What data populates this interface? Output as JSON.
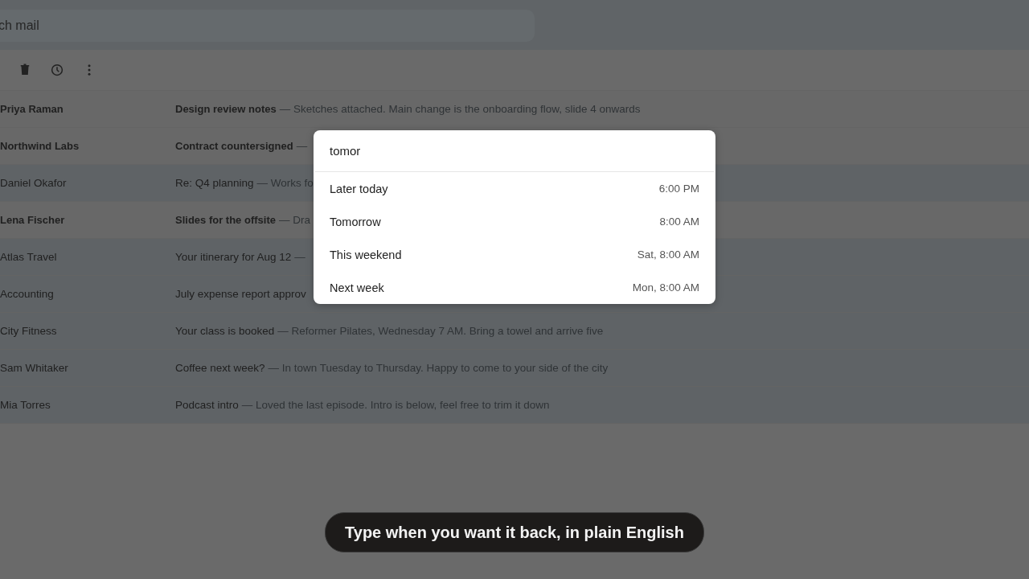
{
  "search": {
    "placeholder": "ch mail"
  },
  "messages": [
    {
      "sender": "Priya Raman",
      "subject": "Design review notes",
      "snippet": "— Sketches attached. Main change is the onboarding flow, slide 4 onwards",
      "unread": true
    },
    {
      "sender": "Northwind Labs",
      "subject": "Contract countersigned",
      "snippet": "—",
      "unread": true
    },
    {
      "sender": "Daniel Okafor",
      "subject": "Re: Q4 planning",
      "snippet": "— Works fo",
      "unread": false
    },
    {
      "sender": "Lena Fischer",
      "subject": "Slides for the offsite",
      "snippet": "— Dra",
      "unread": true
    },
    {
      "sender": "Atlas Travel",
      "subject": "Your itinerary for Aug 12",
      "snippet": "—",
      "unread": false
    },
    {
      "sender": "Accounting",
      "subject": "July expense report approv",
      "unread": false
    },
    {
      "sender": "City Fitness",
      "subject": "Your class is booked",
      "snippet": "— Reformer Pilates, Wednesday 7 AM. Bring a towel and arrive five",
      "unread": false
    },
    {
      "sender": "Sam Whitaker",
      "subject": "Coffee next week?",
      "snippet": "— In town Tuesday to Thursday. Happy to come to your side of the city",
      "unread": false
    },
    {
      "sender": "Mia Torres",
      "subject": "Podcast intro",
      "snippet": "— Loved the last episode. Intro is below, feel free to trim it down",
      "unread": false
    }
  ],
  "snooze_popup": {
    "value": "tomor",
    "options": [
      {
        "label": "Later today",
        "time": "6:00 PM"
      },
      {
        "label": "Tomorrow",
        "time": "8:00 AM"
      },
      {
        "label": "This weekend",
        "time": "Sat, 8:00 AM"
      },
      {
        "label": "Next week",
        "time": "Mon, 8:00 AM"
      }
    ]
  },
  "caption": "Type when you want it back, in plain English"
}
